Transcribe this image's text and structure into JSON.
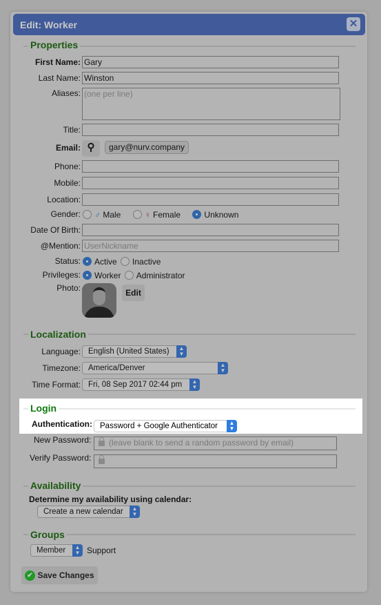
{
  "dialog": {
    "title": "Edit: Worker",
    "close_icon": "close-icon"
  },
  "properties": {
    "heading": "Properties",
    "first_name_label": "First Name:",
    "first_name": "Gary",
    "last_name_label": "Last Name:",
    "last_name": "Winston",
    "aliases_label": "Aliases:",
    "aliases_placeholder": "(one per line)",
    "title_label": "Title:",
    "title": "",
    "email_label": "Email:",
    "email": "gary@nurv.company",
    "phone_label": "Phone:",
    "mobile_label": "Mobile:",
    "location_label": "Location:",
    "gender_label": "Gender:",
    "gender_options": [
      "Male",
      "Female",
      "Unknown"
    ],
    "gender_selected": "Unknown",
    "dob_label": "Date Of Birth:",
    "mention_label": "@Mention:",
    "mention_placeholder": "UserNickname",
    "status_label": "Status:",
    "status_options": [
      "Active",
      "Inactive"
    ],
    "status_selected": "Active",
    "privileges_label": "Privileges:",
    "privileges_options": [
      "Worker",
      "Administrator"
    ],
    "privileges_selected": "Worker",
    "photo_label": "Photo:",
    "photo_edit": "Edit"
  },
  "localization": {
    "heading": "Localization",
    "language_label": "Language:",
    "language": "English (United States)",
    "timezone_label": "Timezone:",
    "timezone": "America/Denver",
    "time_format_label": "Time Format:",
    "time_format": "Fri, 08 Sep 2017 02:44 pm"
  },
  "login": {
    "heading": "Login",
    "auth_label": "Authentication:",
    "auth": "Password + Google Authenticator",
    "new_password_label": "New Password:",
    "new_password_placeholder": "(leave blank to send a random password by email)",
    "verify_password_label": "Verify Password:"
  },
  "availability": {
    "heading": "Availability",
    "label": "Determine my availability using calendar:",
    "calendar": "Create a new calendar"
  },
  "groups": {
    "heading": "Groups",
    "role": "Member",
    "group": "Support"
  },
  "save_label": "Save Changes",
  "colors": {
    "header": "#405a9a",
    "heading": "#1c5a12",
    "accent": "#2f7de1"
  }
}
